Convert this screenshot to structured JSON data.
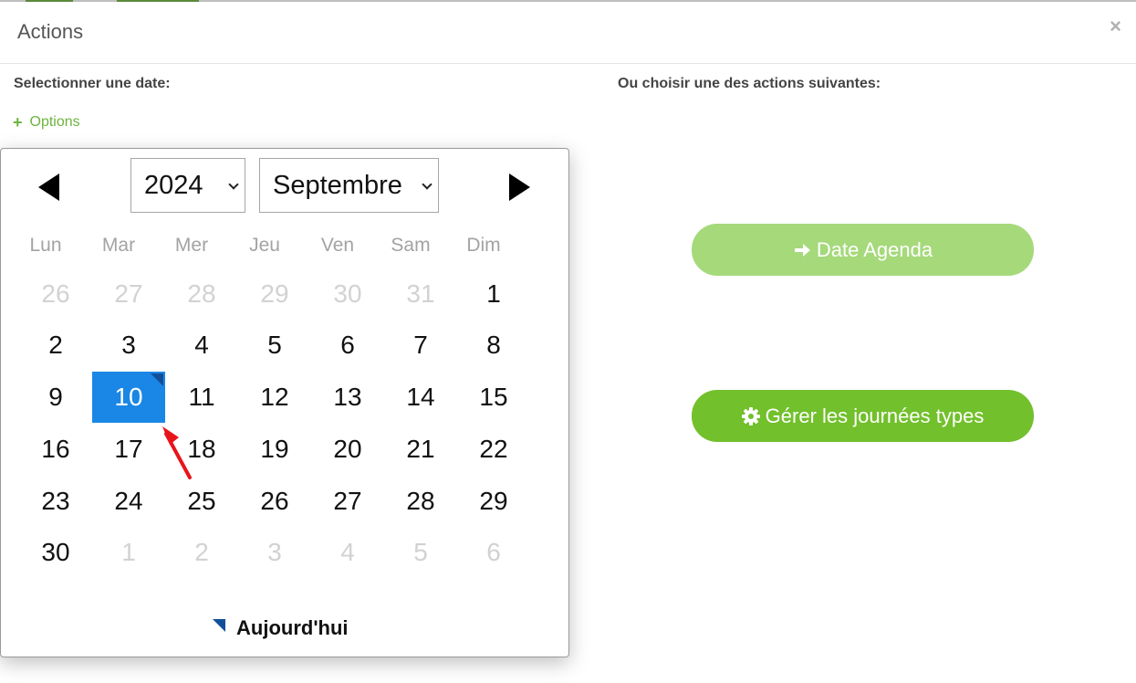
{
  "modal": {
    "title": "Actions",
    "close_label": "×",
    "left_label": "Selectionner une date:",
    "right_label": "Ou choisir une des actions suivantes:",
    "options_icon": "+",
    "options_label": "Options"
  },
  "calendar": {
    "year": "2024",
    "month": "Septembre",
    "weekdays": [
      "Lun",
      "Mar",
      "Mer",
      "Jeu",
      "Ven",
      "Sam",
      "Dim"
    ],
    "weeks": [
      [
        "26",
        "27",
        "28",
        "29",
        "30",
        "31",
        "1"
      ],
      [
        "2",
        "3",
        "4",
        "5",
        "6",
        "7",
        "8"
      ],
      [
        "9",
        "10",
        "11",
        "12",
        "13",
        "14",
        "15"
      ],
      [
        "16",
        "17",
        "18",
        "19",
        "20",
        "21",
        "22"
      ],
      [
        "23",
        "24",
        "25",
        "26",
        "27",
        "28",
        "29"
      ],
      [
        "30",
        "1",
        "2",
        "3",
        "4",
        "5",
        "6"
      ]
    ],
    "selected_day": "10",
    "today_label": "Aujourd'hui"
  },
  "actions": {
    "date_agenda_label": "Date Agenda",
    "gerer_label": "Gérer les journées types"
  },
  "colors": {
    "accent_green": "#72c02c",
    "light_green": "#a5d97a",
    "selected_blue": "#1a87e6",
    "today_marker": "#124f9a",
    "annotation_arrow": "#e8141b"
  },
  "icons": {
    "prev": "triangle-left-icon",
    "next": "triangle-right-icon",
    "agenda": "arrow-right-icon",
    "gerer": "gear-icon"
  }
}
